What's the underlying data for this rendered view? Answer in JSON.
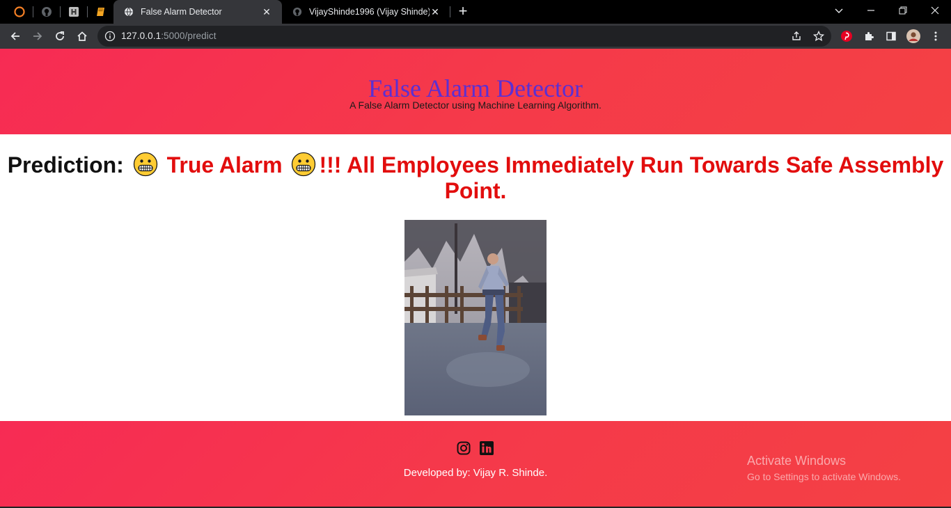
{
  "browser": {
    "tabs": [
      {
        "title": "False Alarm Detector",
        "icon": "globe-icon",
        "active": true
      },
      {
        "title": "VijayShinde1996 (Vijay Shinde)",
        "icon": "github-icon",
        "active": false
      }
    ],
    "pinned_icons": [
      "orange-ring-icon",
      "github-icon",
      "hashnode-icon",
      "book-icon"
    ],
    "address": {
      "host": "127.0.0.1",
      "rest": ":5000/predict"
    }
  },
  "header": {
    "title": "False Alarm Detector",
    "subtitle": "A False Alarm Detector using Machine Learning Algorithm."
  },
  "prediction": {
    "label": "Prediction:",
    "result": "True Alarm",
    "message": "!!! All Employees Immediately Run Towards Safe Assembly Point.",
    "emoji": "grimacing-face"
  },
  "footer": {
    "social": [
      "instagram-icon",
      "linkedin-icon"
    ],
    "credit": "Developed by: Vijay R. Shinde."
  },
  "os_watermark": {
    "line1": "Activate Windows",
    "line2": "Go to Settings to activate Windows."
  },
  "colors": {
    "accent_gradient_start": "#f72b54",
    "accent_gradient_end": "#f44144",
    "title_purple": "#5b2fd3",
    "alarm_red": "#e20d0d"
  }
}
